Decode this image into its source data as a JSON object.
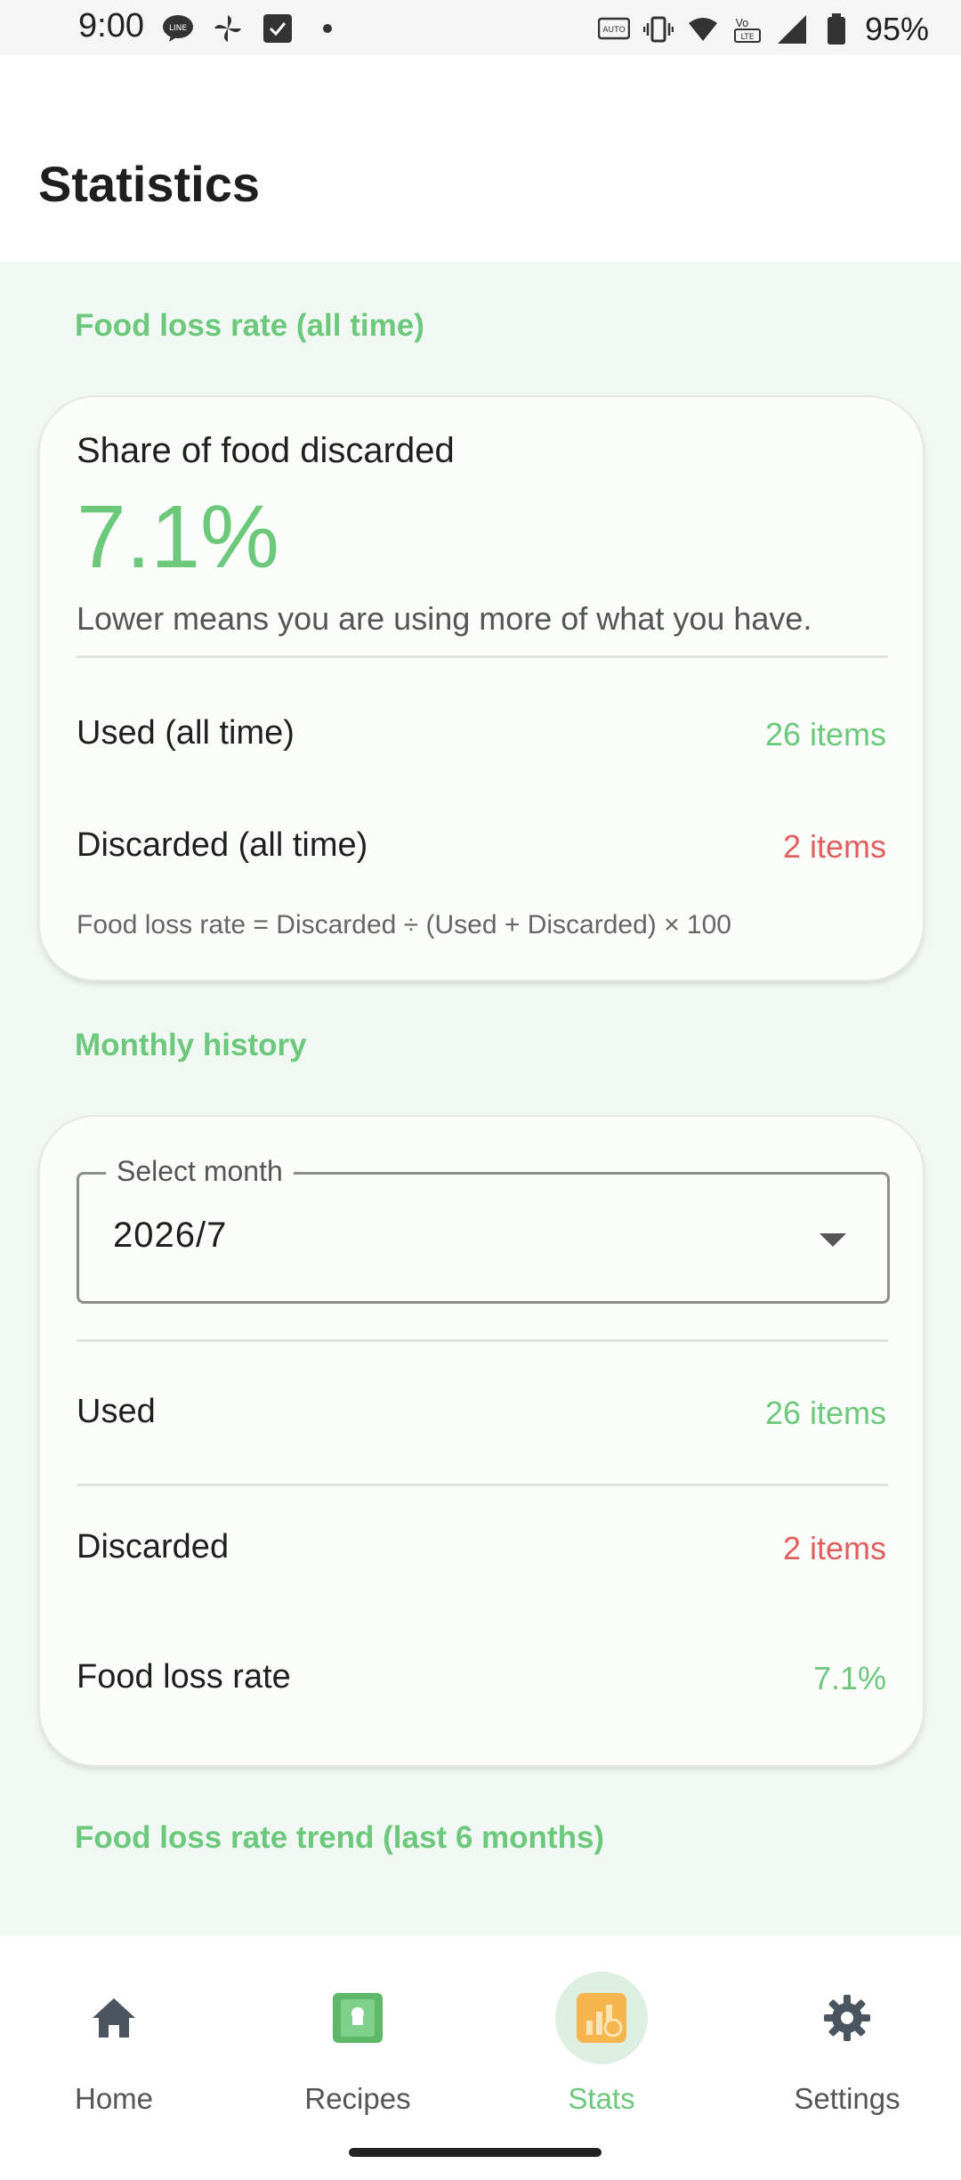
{
  "status_bar": {
    "time": "9:00",
    "battery_pct": "95%"
  },
  "header": {
    "title": "Statistics"
  },
  "overall": {
    "section_title": "Food loss rate (all time)",
    "heading": "Share of food discarded",
    "rate": "7.1%",
    "subtitle": "Lower means you are using more of what you have.",
    "used_label": "Used (all time)",
    "used_value": "26 items",
    "discarded_label": "Discarded (all time)",
    "discarded_value": "2 items",
    "formula": "Food loss rate = Discarded ÷ (Used + Discarded) × 100"
  },
  "monthly": {
    "section_title": "Monthly history",
    "select_label": "Select month",
    "selected_month": "2026/7",
    "used_label": "Used",
    "used_value": "26 items",
    "discarded_label": "Discarded",
    "discarded_value": "2 items",
    "rate_label": "Food loss rate",
    "rate_value": "7.1%"
  },
  "trend": {
    "section_title": "Food loss rate trend (last 6 months)"
  },
  "nav": {
    "items": [
      {
        "label": "Home",
        "icon": "home-icon"
      },
      {
        "label": "Recipes",
        "icon": "recipe-book-icon"
      },
      {
        "label": "Stats",
        "icon": "stats-chart-icon"
      },
      {
        "label": "Settings",
        "icon": "gear-icon"
      }
    ],
    "active": "Stats"
  },
  "colors": {
    "accent_green": "#6cc97c",
    "discard_red": "#e06060",
    "content_bg": "#f1f7f2"
  }
}
